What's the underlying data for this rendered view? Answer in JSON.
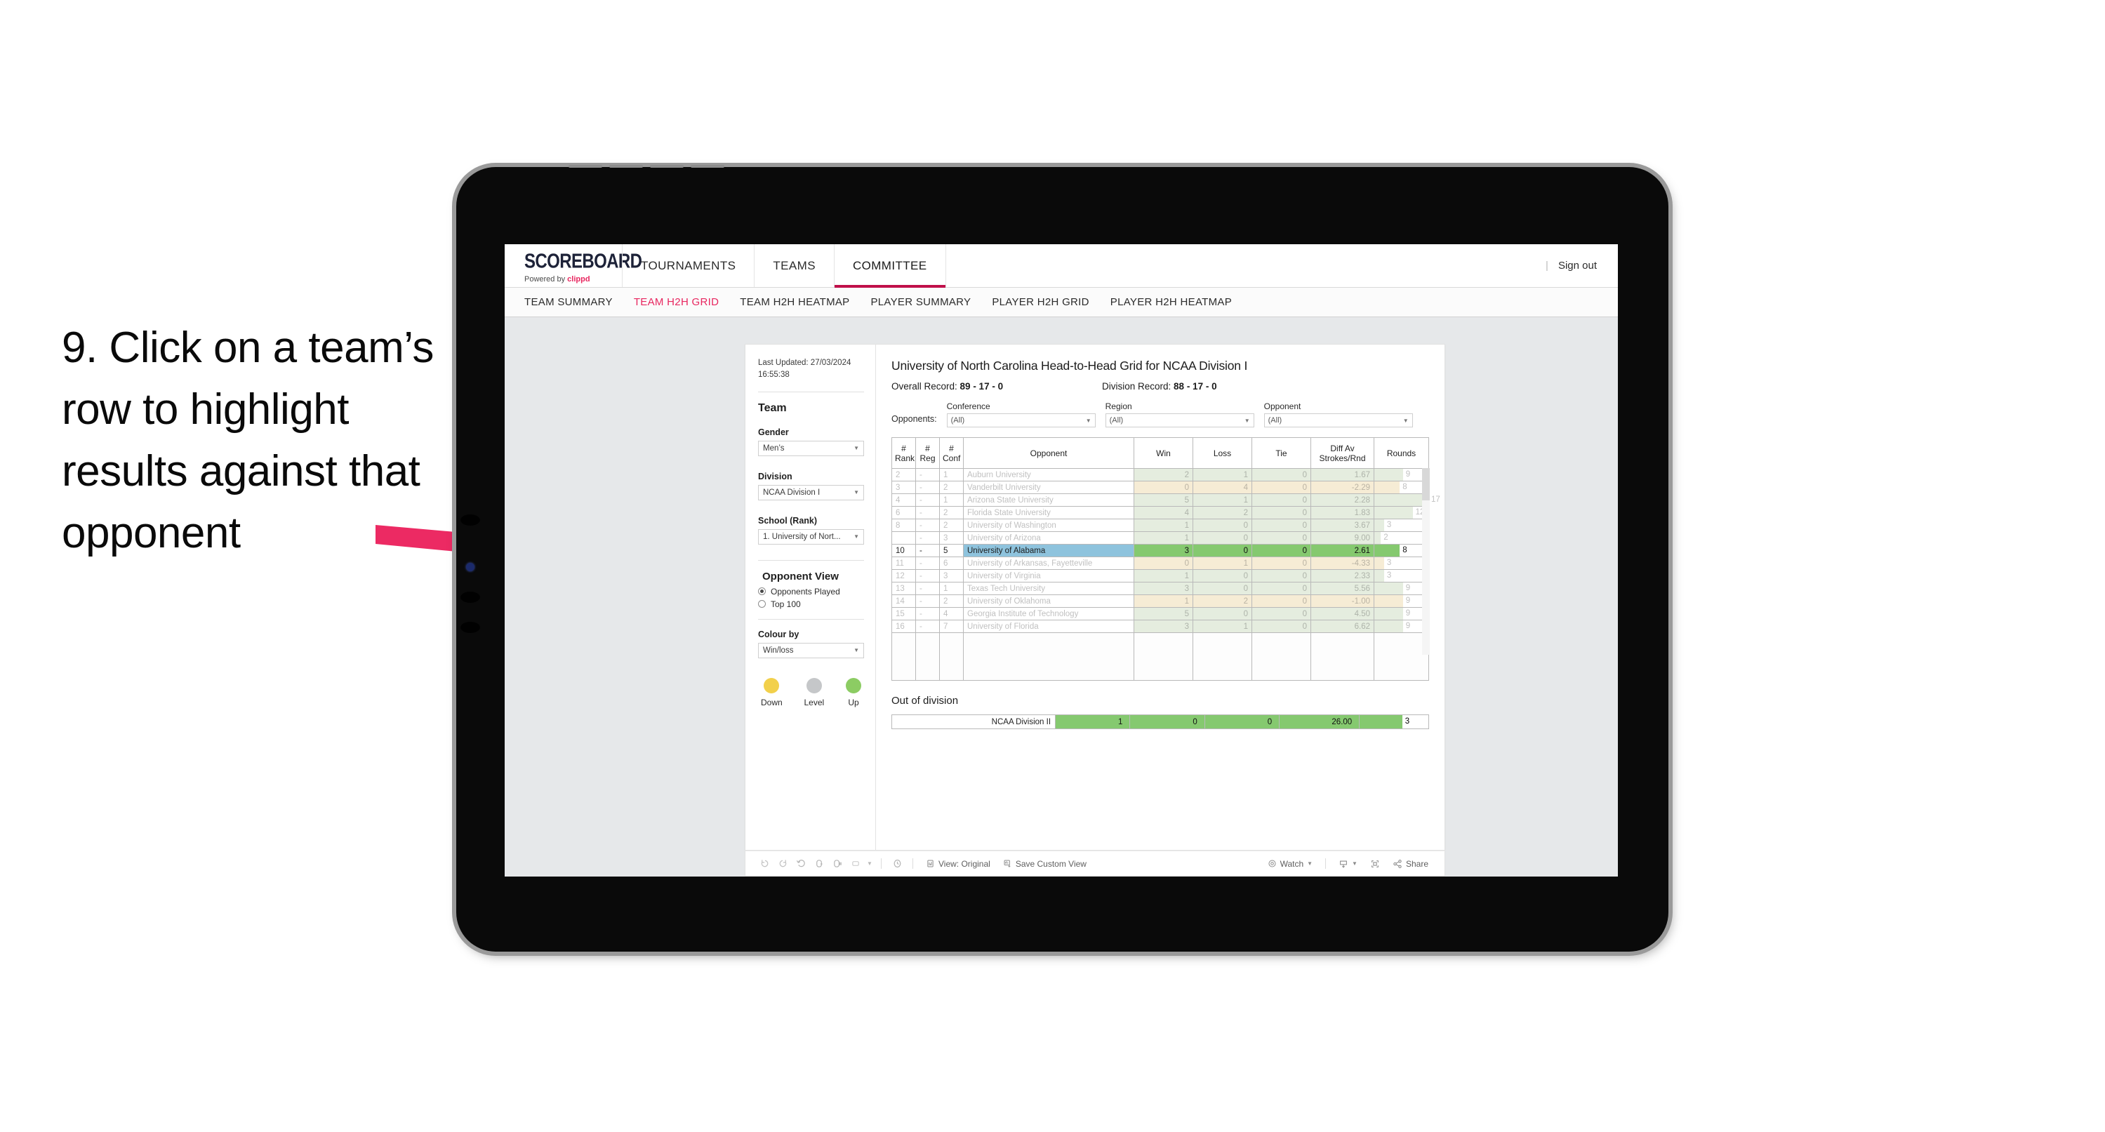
{
  "annotation": {
    "text": "9. Click on a team’s row to highlight results against that opponent",
    "arrow_color": "#ec2a63"
  },
  "header": {
    "brand_title": "SCOREBOARD",
    "brand_sub_prefix": "Powered by ",
    "brand_sub_name": "clippd",
    "tabs": [
      {
        "label": "TOURNAMENTS",
        "active": false
      },
      {
        "label": "TEAMS",
        "active": false
      },
      {
        "label": "COMMITTEE",
        "active": true
      }
    ],
    "divider": "|",
    "sign_out": "Sign out"
  },
  "subnav": {
    "tabs": [
      {
        "label": "TEAM SUMMARY",
        "active": false
      },
      {
        "label": "TEAM H2H GRID",
        "active": true
      },
      {
        "label": "TEAM H2H HEATMAP",
        "active": false
      },
      {
        "label": "PLAYER SUMMARY",
        "active": false
      },
      {
        "label": "PLAYER H2H GRID",
        "active": false
      },
      {
        "label": "PLAYER H2H HEATMAP",
        "active": false
      }
    ]
  },
  "sidebar": {
    "last_updated": "Last Updated: 27/03/2024 16:55:38",
    "team_heading": "Team",
    "gender_label": "Gender",
    "gender_value": "Men’s",
    "division_label": "Division",
    "division_value": "NCAA Division I",
    "school_label": "School (Rank)",
    "school_value": "1. University of Nort...",
    "opponent_view_heading": "Opponent View",
    "radio_options": [
      {
        "label": "Opponents Played",
        "selected": true
      },
      {
        "label": "Top 100",
        "selected": false
      }
    ],
    "colour_by_label": "Colour by",
    "colour_by_value": "Win/loss",
    "legend": [
      {
        "label": "Down",
        "color": "#f2d04b"
      },
      {
        "label": "Level",
        "color": "#c5c7c9"
      },
      {
        "label": "Up",
        "color": "#8ccc63"
      }
    ]
  },
  "panel": {
    "title": "University of North Carolina Head-to-Head Grid for NCAA Division I",
    "overall_record_label": "Overall Record: ",
    "overall_record_value": "89 - 17 - 0",
    "division_record_label": "Division Record: ",
    "division_record_value": "88 - 17 - 0",
    "opponents_label": "Opponents:",
    "filters": [
      {
        "label": "Conference",
        "value": "(All)"
      },
      {
        "label": "Region",
        "value": "(All)"
      },
      {
        "label": "Opponent",
        "value": "(All)"
      }
    ]
  },
  "chart_data": {
    "type": "table",
    "title": "University of North Carolina Head-to-Head Grid for NCAA Division I",
    "columns": [
      "# Rank",
      "# Reg",
      "# Conf",
      "Opponent",
      "Win",
      "Loss",
      "Tie",
      "Diff Av Strokes/Rnd",
      "Rounds"
    ],
    "column_header_lines": [
      [
        "#",
        "Rank"
      ],
      [
        "#",
        "Reg"
      ],
      [
        "#",
        "Conf"
      ],
      [
        "Opponent"
      ],
      [
        "Win"
      ],
      [
        "Loss"
      ],
      [
        "Tie"
      ],
      [
        "Diff Av",
        "Strokes/Rnd"
      ],
      [
        "Rounds"
      ]
    ],
    "rows": [
      {
        "rank": "2",
        "reg": "-",
        "conf": "1",
        "opponent": "Auburn University",
        "win": "2",
        "loss": "1",
        "tie": "0",
        "diff": "1.67",
        "rounds": "9",
        "tone": "green",
        "selected": false
      },
      {
        "rank": "3",
        "reg": "-",
        "conf": "2",
        "opponent": "Vanderbilt University",
        "win": "0",
        "loss": "4",
        "tie": "0",
        "diff": "-2.29",
        "rounds": "8",
        "tone": "amber",
        "selected": false
      },
      {
        "rank": "4",
        "reg": "-",
        "conf": "1",
        "opponent": "Arizona State University",
        "win": "5",
        "loss": "1",
        "tie": "0",
        "diff": "2.28",
        "rounds": "17",
        "tone": "green",
        "selected": false
      },
      {
        "rank": "6",
        "reg": "-",
        "conf": "2",
        "opponent": "Florida State University",
        "win": "4",
        "loss": "2",
        "tie": "0",
        "diff": "1.83",
        "rounds": "12",
        "tone": "green",
        "selected": false
      },
      {
        "rank": "8",
        "reg": "-",
        "conf": "2",
        "opponent": "University of Washington",
        "win": "1",
        "loss": "0",
        "tie": "0",
        "diff": "3.67",
        "rounds": "3",
        "tone": "green",
        "selected": false
      },
      {
        "rank": "",
        "reg": "-",
        "conf": "3",
        "opponent": "University of Arizona",
        "win": "1",
        "loss": "0",
        "tie": "0",
        "diff": "9.00",
        "rounds": "2",
        "tone": "green",
        "selected": false
      },
      {
        "rank": "10",
        "reg": "-",
        "conf": "5",
        "opponent": "University of Alabama",
        "win": "3",
        "loss": "0",
        "tie": "0",
        "diff": "2.61",
        "rounds": "8",
        "tone": "green",
        "selected": true
      },
      {
        "rank": "11",
        "reg": "-",
        "conf": "6",
        "opponent": "University of Arkansas, Fayetteville",
        "win": "0",
        "loss": "1",
        "tie": "0",
        "diff": "-4.33",
        "rounds": "3",
        "tone": "amber",
        "selected": false
      },
      {
        "rank": "12",
        "reg": "-",
        "conf": "3",
        "opponent": "University of Virginia",
        "win": "1",
        "loss": "0",
        "tie": "0",
        "diff": "2.33",
        "rounds": "3",
        "tone": "green",
        "selected": false
      },
      {
        "rank": "13",
        "reg": "-",
        "conf": "1",
        "opponent": "Texas Tech University",
        "win": "3",
        "loss": "0",
        "tie": "0",
        "diff": "5.56",
        "rounds": "9",
        "tone": "green",
        "selected": false
      },
      {
        "rank": "14",
        "reg": "-",
        "conf": "2",
        "opponent": "University of Oklahoma",
        "win": "1",
        "loss": "2",
        "tie": "0",
        "diff": "-1.00",
        "rounds": "9",
        "tone": "amber",
        "selected": false
      },
      {
        "rank": "15",
        "reg": "-",
        "conf": "4",
        "opponent": "Georgia Institute of Technology",
        "win": "5",
        "loss": "0",
        "tie": "0",
        "diff": "4.50",
        "rounds": "9",
        "tone": "green",
        "selected": false
      },
      {
        "rank": "16",
        "reg": "-",
        "conf": "7",
        "opponent": "University of Florida",
        "win": "3",
        "loss": "1",
        "tie": "0",
        "diff": "6.62",
        "rounds": "9",
        "tone": "green",
        "selected": false
      }
    ],
    "out_of_division": {
      "title": "Out of division",
      "label": "NCAA Division II",
      "win": "1",
      "loss": "0",
      "tie": "0",
      "diff": "26.00",
      "rounds": "3"
    }
  },
  "toolbar": {
    "icons": [
      "undo-icon",
      "redo-icon",
      "revert-icon",
      "refresh-icon",
      "pause-icon",
      "shape-dropdown-icon",
      "clock-icon"
    ],
    "view_label": "View: Original",
    "save_label": "Save Custom View",
    "watch_label": "Watch",
    "download_label": "download-icon",
    "fullscreen_label": "fullscreen-icon",
    "share_label": "Share"
  }
}
